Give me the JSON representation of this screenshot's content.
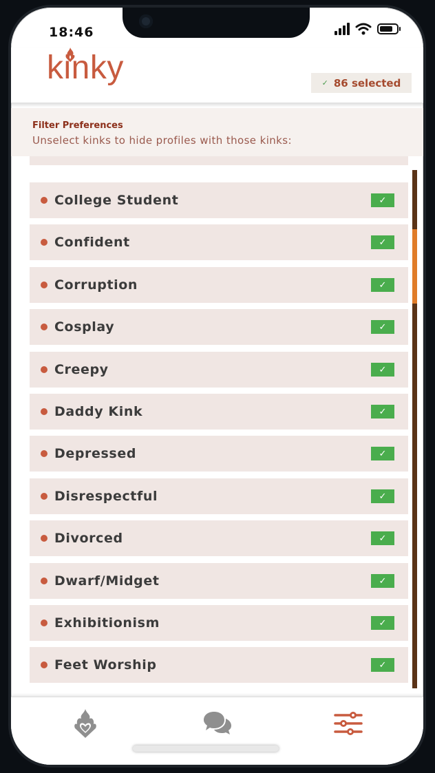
{
  "status_bar": {
    "time": "18:46"
  },
  "header": {
    "logo_text": "kinky",
    "selected_text": "86 selected"
  },
  "filter": {
    "title": "Filter Preferences",
    "subtitle": "Unselect kinks to hide profiles with those kinks:"
  },
  "kinks": [
    {
      "label": "College Student",
      "checked": true
    },
    {
      "label": "Confident",
      "checked": true
    },
    {
      "label": "Corruption",
      "checked": true
    },
    {
      "label": "Cosplay",
      "checked": true
    },
    {
      "label": "Creepy",
      "checked": true
    },
    {
      "label": "Daddy Kink",
      "checked": true
    },
    {
      "label": "Depressed",
      "checked": true
    },
    {
      "label": "Disrespectful",
      "checked": true
    },
    {
      "label": "Divorced",
      "checked": true
    },
    {
      "label": "Dwarf/Midget",
      "checked": true
    },
    {
      "label": "Exhibitionism",
      "checked": true
    },
    {
      "label": "Feet Worship",
      "checked": true
    }
  ],
  "checkmark": "✓",
  "nav": {
    "items": [
      {
        "icon": "flame-heart-icon",
        "active": false
      },
      {
        "icon": "chat-bubbles-icon",
        "active": false
      },
      {
        "icon": "sliders-icon",
        "active": true
      }
    ]
  },
  "colors": {
    "accent": "#c85b3f",
    "check_green": "#4aad4d",
    "row_bg": "#f0e6e3",
    "scroll_thumb": "#e07c29"
  }
}
